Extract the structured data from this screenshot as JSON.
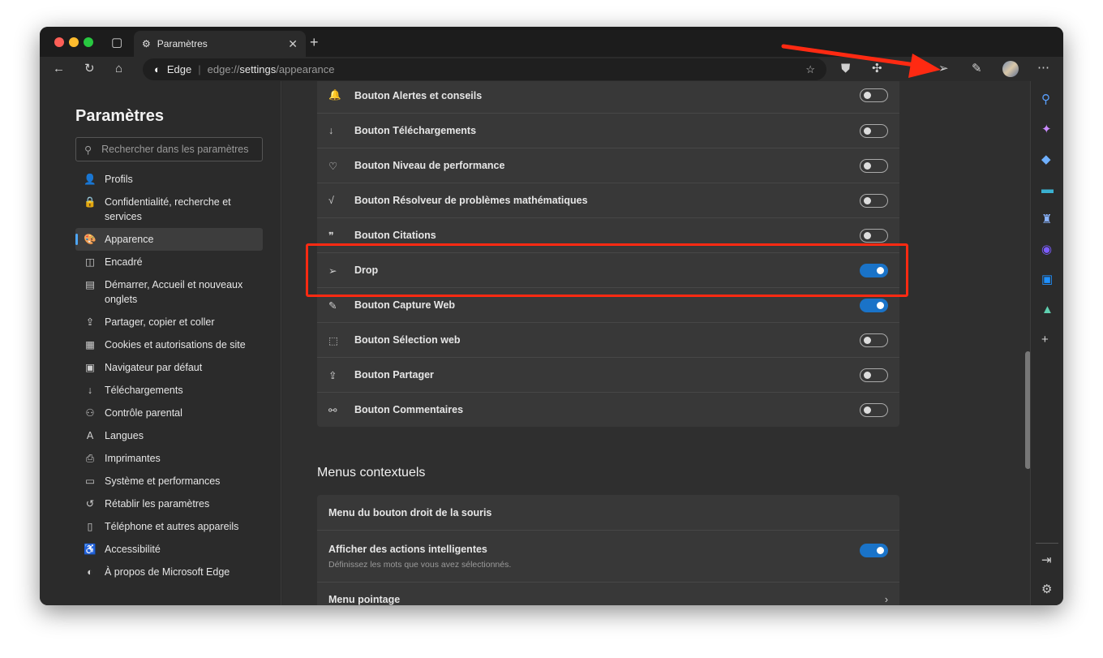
{
  "window": {
    "tab_title": "Paramètres",
    "address_brand": "Edge",
    "url_prefix": "edge://",
    "url_bold": "settings",
    "url_suffix": "/appearance"
  },
  "sidebar": {
    "title": "Paramètres",
    "search_placeholder": "Rechercher dans les paramètres",
    "items": [
      {
        "label": "Profils",
        "icon": "profile-icon",
        "glyph": "👤"
      },
      {
        "label": "Confidentialité, recherche et services",
        "icon": "lock-icon",
        "glyph": "🔒"
      },
      {
        "label": "Apparence",
        "icon": "palette-icon",
        "glyph": "🎨",
        "selected": true
      },
      {
        "label": "Encadré",
        "icon": "sidebar-icon",
        "glyph": "◫"
      },
      {
        "label": "Démarrer, Accueil et nouveaux onglets",
        "icon": "home-tabs-icon",
        "glyph": "▤"
      },
      {
        "label": "Partager, copier et coller",
        "icon": "share-icon",
        "glyph": "⇪"
      },
      {
        "label": "Cookies et autorisations de site",
        "icon": "cookies-icon",
        "glyph": "▦"
      },
      {
        "label": "Navigateur par défaut",
        "icon": "browser-icon",
        "glyph": "▣"
      },
      {
        "label": "Téléchargements",
        "icon": "download-icon",
        "glyph": "↓"
      },
      {
        "label": "Contrôle parental",
        "icon": "family-icon",
        "glyph": "⚇"
      },
      {
        "label": "Langues",
        "icon": "languages-icon",
        "glyph": "A"
      },
      {
        "label": "Imprimantes",
        "icon": "printer-icon",
        "glyph": "⎙"
      },
      {
        "label": "Système et performances",
        "icon": "laptop-icon",
        "glyph": "▭"
      },
      {
        "label": "Rétablir les paramètres",
        "icon": "reset-icon",
        "glyph": "↺"
      },
      {
        "label": "Téléphone et autres appareils",
        "icon": "phone-icon",
        "glyph": "▯"
      },
      {
        "label": "Accessibilité",
        "icon": "accessibility-icon",
        "glyph": "♿"
      },
      {
        "label": "À propos de Microsoft Edge",
        "icon": "edge-icon",
        "glyph": "◐"
      }
    ]
  },
  "toolbar_buttons": [
    {
      "label": "Bouton Alertes et conseils",
      "icon": "bell-icon",
      "glyph": "🔔",
      "on": false
    },
    {
      "label": "Bouton Téléchargements",
      "icon": "download-icon",
      "glyph": "↓",
      "on": false
    },
    {
      "label": "Bouton Niveau de performance",
      "icon": "heartbeat-icon",
      "glyph": "♡",
      "on": false
    },
    {
      "label": "Bouton Résolveur de problèmes mathématiques",
      "icon": "math-solver-icon",
      "glyph": "√",
      "on": false
    },
    {
      "label": "Bouton Citations",
      "icon": "quote-icon",
      "glyph": "❞",
      "on": false
    },
    {
      "label": "Drop",
      "icon": "send-icon",
      "glyph": "➢",
      "on": true
    },
    {
      "label": "Bouton Capture Web",
      "icon": "web-capture-icon",
      "glyph": "✎",
      "on": true
    },
    {
      "label": "Bouton Sélection web",
      "icon": "web-select-icon",
      "glyph": "⬚",
      "on": false
    },
    {
      "label": "Bouton Partager",
      "icon": "share-icon",
      "glyph": "⇪",
      "on": false
    },
    {
      "label": "Bouton Commentaires",
      "icon": "feedback-icon",
      "glyph": "⚯",
      "on": false
    }
  ],
  "context_menus": {
    "title": "Menus contextuels",
    "right_click": "Menu du bouton droit de la souris",
    "smart_actions": "Afficher des actions intelligentes",
    "smart_actions_desc": "Définissez les mots que vous avez sélectionnés.",
    "smart_actions_on": true,
    "hover_menu": "Menu pointage"
  },
  "colors": {
    "accent": "#1a73c8",
    "annotation": "#ff2a12"
  }
}
